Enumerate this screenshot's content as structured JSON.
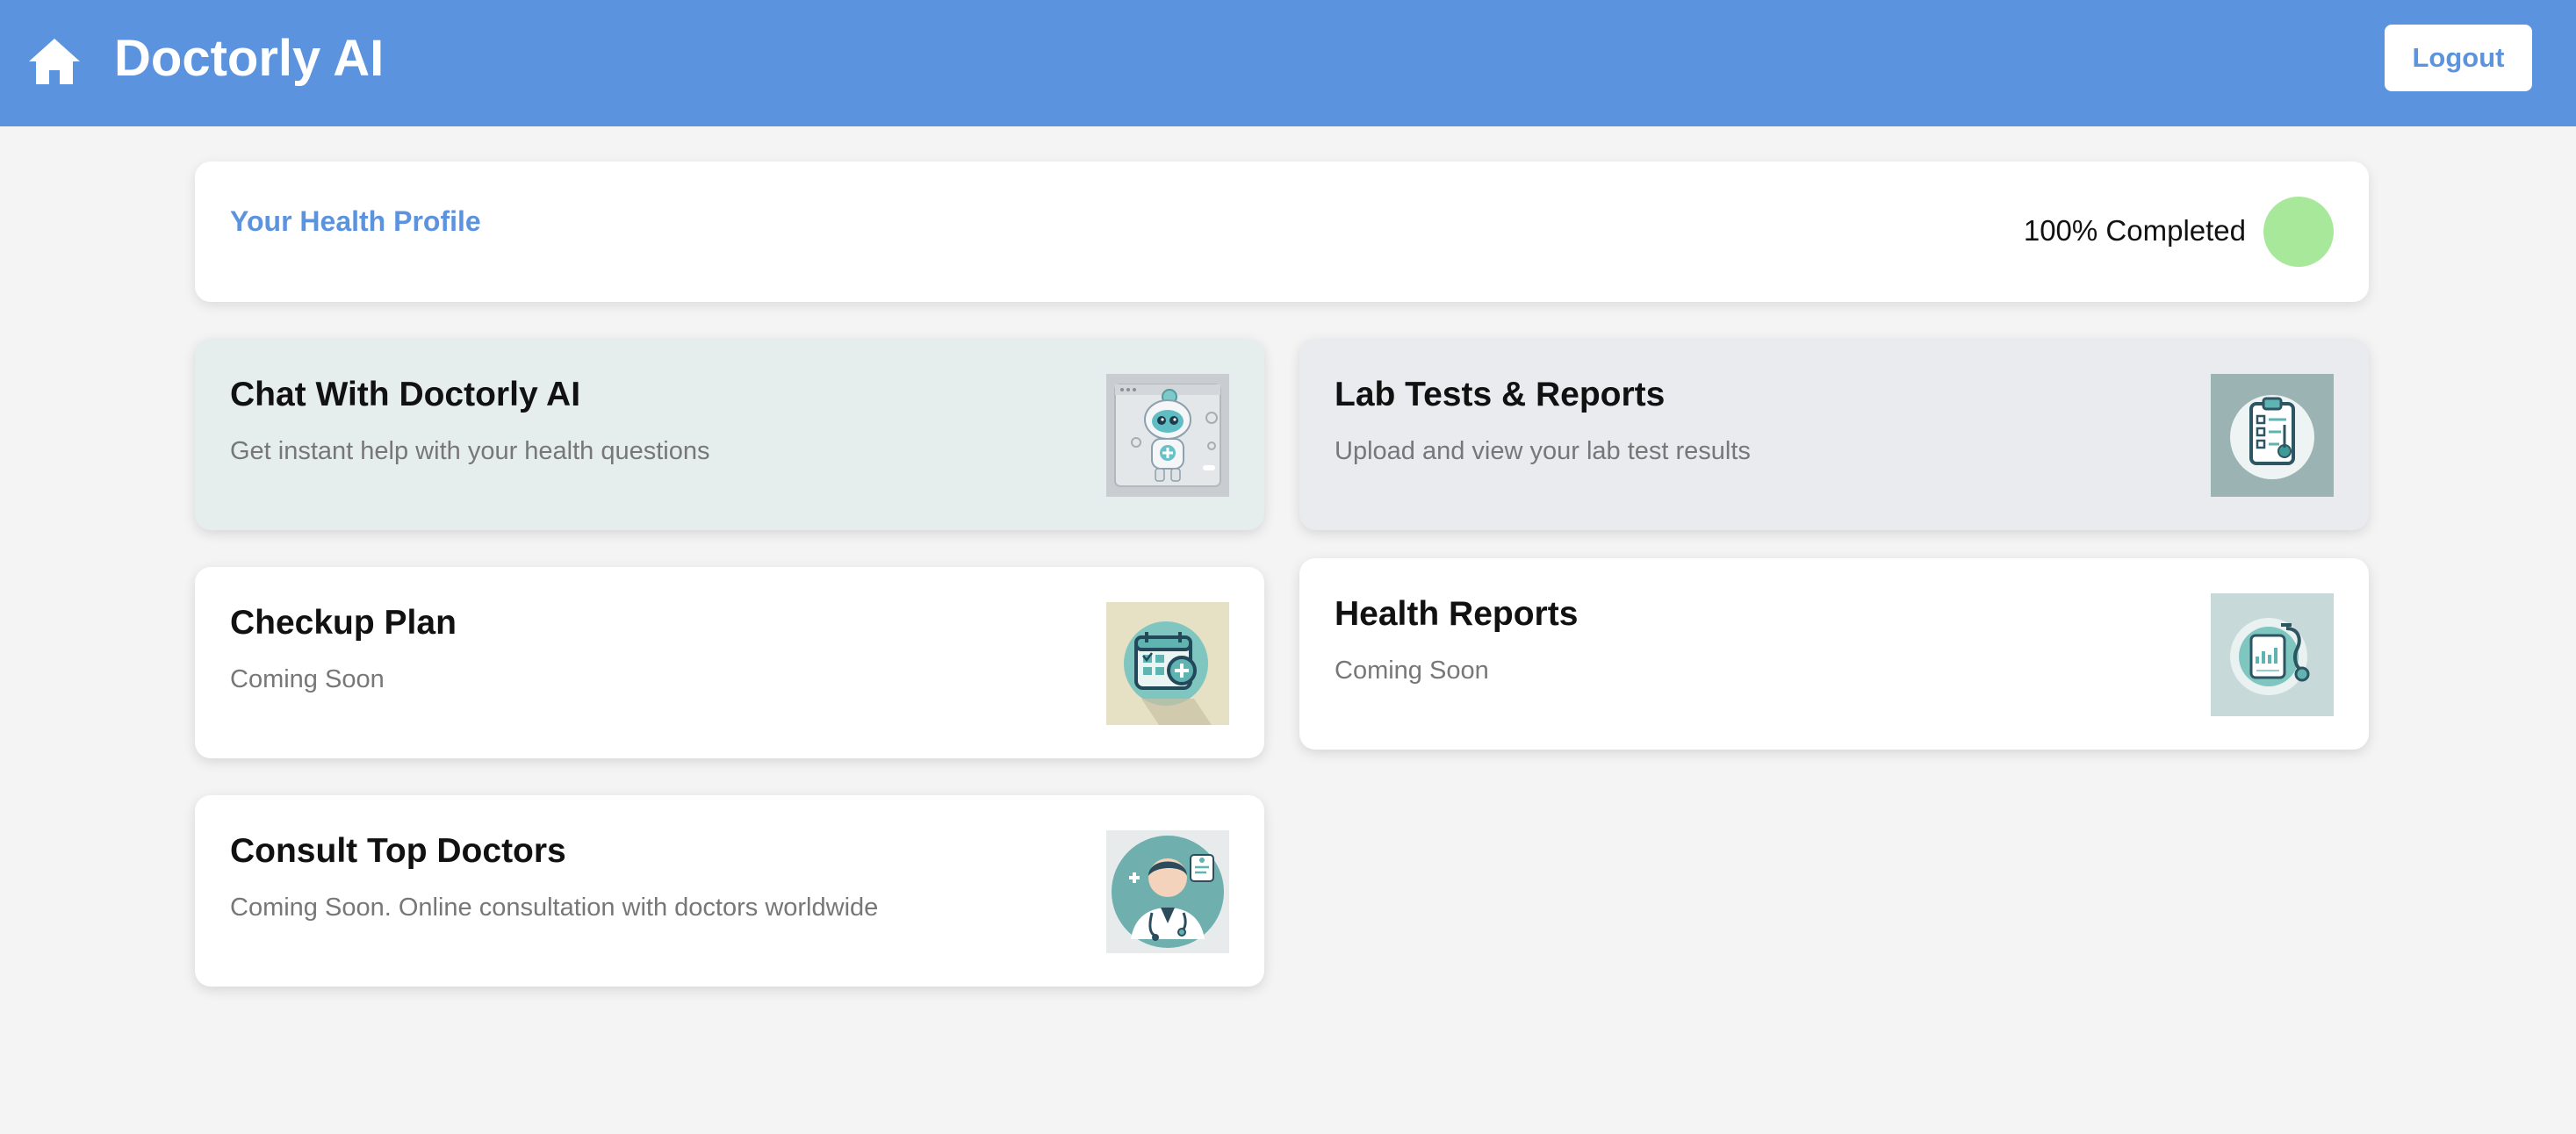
{
  "header": {
    "title": "Doctorly AI",
    "home_icon": "home-icon",
    "logout_label": "Logout",
    "background": "#5b93df"
  },
  "profile": {
    "title": "Your Health Profile",
    "status": "100% Completed",
    "completion": 1.0,
    "indicator_color": "#a8e89a"
  },
  "cards": [
    {
      "title": "Chat With Doctorly AI",
      "description": "Get instant help with your health questions",
      "icon": "robot-doctor-illustration"
    },
    {
      "title": "Lab Tests & Reports",
      "description": "Upload and view your lab test results",
      "icon": "clipboard-illustration"
    },
    {
      "title": "Checkup Plan",
      "description": "Coming Soon",
      "icon": "calendar-illustration"
    },
    {
      "title": "Health Reports",
      "description": "Coming Soon",
      "icon": "stethoscope-report-illustration"
    },
    {
      "title": "Consult Top Doctors",
      "description": "Coming Soon. Online consultation with doctors worldwide",
      "icon": "doctor-avatar-illustration"
    }
  ]
}
